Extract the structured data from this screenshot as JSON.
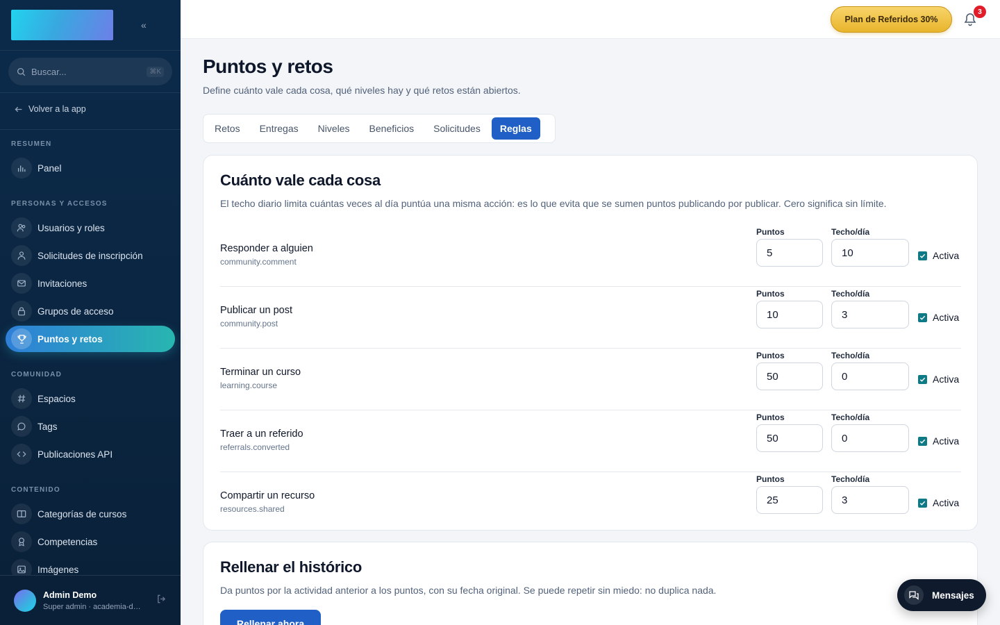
{
  "sidebar": {
    "search_placeholder": "Buscar...",
    "search_shortcut": "⌘K",
    "back_label": "Volver a la app",
    "sections": [
      {
        "label": "RESUMEN",
        "items": [
          {
            "label": "Panel",
            "icon": "bar-chart-icon"
          }
        ]
      },
      {
        "label": "PERSONAS Y ACCESOS",
        "items": [
          {
            "label": "Usuarios y roles",
            "icon": "users-icon"
          },
          {
            "label": "Solicitudes de inscripción",
            "icon": "user-icon"
          },
          {
            "label": "Invitaciones",
            "icon": "mail-icon"
          },
          {
            "label": "Grupos de acceso",
            "icon": "lock-icon"
          },
          {
            "label": "Puntos y retos",
            "icon": "trophy-icon",
            "active": true
          }
        ]
      },
      {
        "label": "COMUNIDAD",
        "items": [
          {
            "label": "Espacios",
            "icon": "hash-icon"
          },
          {
            "label": "Tags",
            "icon": "chat-icon"
          },
          {
            "label": "Publicaciones API",
            "icon": "code-icon"
          }
        ]
      },
      {
        "label": "CONTENIDO",
        "items": [
          {
            "label": "Categorías de cursos",
            "icon": "book-icon"
          },
          {
            "label": "Competencias",
            "icon": "badge-icon"
          },
          {
            "label": "Imágenes",
            "icon": "image-icon"
          }
        ]
      }
    ],
    "user": {
      "name": "Admin Demo",
      "role": "Super admin · academia-demo"
    }
  },
  "topbar": {
    "referral_label": "Plan de Referidos 30%",
    "notifications_count": "3",
    "accent_gold": "#e8b52c",
    "badge_color": "#e11d2a"
  },
  "page": {
    "title": "Puntos y retos",
    "subtitle": "Define cuánto vale cada cosa, qué niveles hay y qué retos están abiertos."
  },
  "tabs": [
    {
      "label": "Retos"
    },
    {
      "label": "Entregas"
    },
    {
      "label": "Niveles"
    },
    {
      "label": "Beneficios"
    },
    {
      "label": "Solicitudes"
    },
    {
      "label": "Reglas",
      "active": true
    }
  ],
  "rules_card": {
    "title": "Cuánto vale cada cosa",
    "description": "El techo diario limita cuántas veces al día puntúa una misma acción: es lo que evita que se sumen puntos publicando por publicar. Cero significa sin límite.",
    "points_label": "Puntos",
    "cap_label": "Techo/día",
    "active_label": "Activa",
    "rules": [
      {
        "name": "Responder a alguien",
        "key": "community.comment",
        "points": "5",
        "cap": "10",
        "active": true
      },
      {
        "name": "Publicar un post",
        "key": "community.post",
        "points": "10",
        "cap": "3",
        "active": true
      },
      {
        "name": "Terminar un curso",
        "key": "learning.course",
        "points": "50",
        "cap": "0",
        "active": true
      },
      {
        "name": "Traer a un referido",
        "key": "referrals.converted",
        "points": "50",
        "cap": "0",
        "active": true
      },
      {
        "name": "Compartir un recurso",
        "key": "resources.shared",
        "points": "25",
        "cap": "3",
        "active": true
      }
    ]
  },
  "backfill_card": {
    "title": "Rellenar el histórico",
    "description": "Da puntos por la actividad anterior a los puntos, con su fecha original. Se puede repetir sin miedo: no duplica nada.",
    "button_label": "Rellenar ahora"
  },
  "messages_label": "Mensajes",
  "colors": {
    "primary": "#1f5fc6",
    "sidebar": "#0b2a4a",
    "checkbox": "#0e7a86"
  }
}
